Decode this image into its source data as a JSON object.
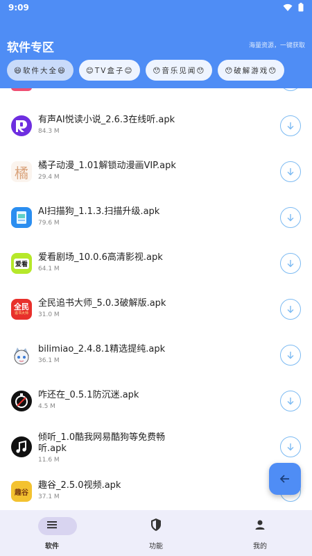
{
  "status_bar": {
    "time": "9:09"
  },
  "header": {
    "title": "软件专区",
    "slogan": "海量资源，一键获取"
  },
  "tabs": [
    {
      "label": "😄软件大全😄",
      "active": true
    },
    {
      "label": "😊TV盒子😊",
      "active": false
    },
    {
      "label": "😯音乐见闻😯",
      "active": false
    },
    {
      "label": "😯破解游戏😯",
      "active": false
    }
  ],
  "apps": [
    {
      "name": "有声AI悦读小说_2.6.3在线听.apk",
      "size": "84.3 M"
    },
    {
      "name": "橘子动漫_1.01解锁动漫画VIP.apk",
      "size": "29.4 M"
    },
    {
      "name": "AI扫描狗_1.1.3.扫描升级.apk",
      "size": "79.6 M"
    },
    {
      "name": "爱看剧场_10.0.6高清影视.apk",
      "size": "64.1 M"
    },
    {
      "name": "全民追书大师_5.0.3破解版.apk",
      "size": "31.0 M"
    },
    {
      "name": "bilimiao_2.4.8.1精选提纯.apk",
      "size": "36.1 M"
    },
    {
      "name": "咋还在_0.5.1防沉迷.apk",
      "size": "4.5 M"
    },
    {
      "name": "倾听_1.0酷我网易酷狗等免费畅听.apk",
      "size": "11.6 M"
    },
    {
      "name": "趣谷_2.5.0视频.apk",
      "size": "37.1 M"
    }
  ],
  "icon_text": {
    "aikan": "爱看",
    "quanmin": "全民",
    "quanmin_sub": "追书大师",
    "qugu": "趣谷",
    "juzi": "橘"
  },
  "bottom_nav": [
    {
      "label": "软件",
      "icon": "menu-icon",
      "active": true
    },
    {
      "label": "功能",
      "icon": "shield-icon",
      "active": false
    },
    {
      "label": "我的",
      "icon": "person-icon",
      "active": false
    }
  ],
  "colors": {
    "primary": "#4f8df5",
    "download_outline": "#7cbaf2",
    "nav_background": "#eeeefa"
  }
}
